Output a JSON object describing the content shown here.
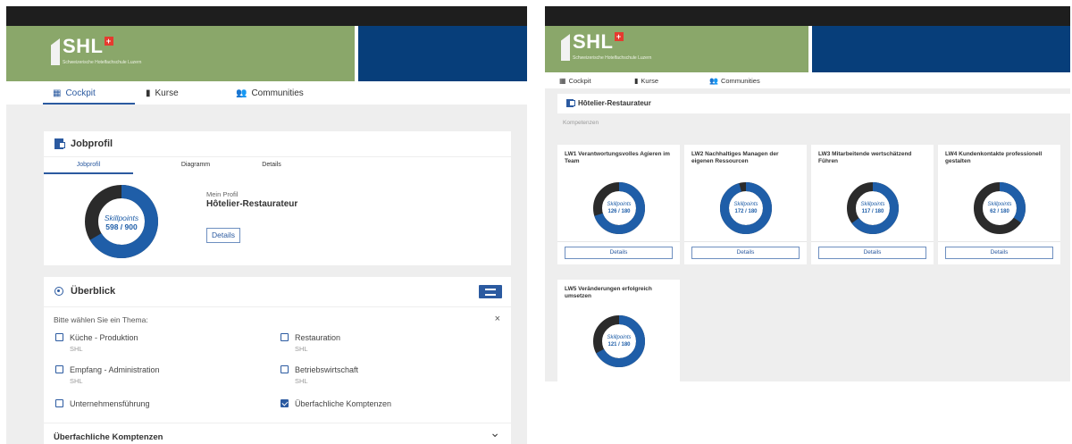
{
  "brand": {
    "logo_text": "SHL",
    "cross": "+",
    "subtitle": "Schweizerische Hotelfachschule Luzern",
    "colors": {
      "green": "#8aa76a",
      "blue": "#073e7a",
      "accent": "#2b5aa0",
      "donut_dark": "#2b2b2b"
    }
  },
  "left": {
    "nav": [
      {
        "label": "Cockpit",
        "icon": "dashboard-icon"
      },
      {
        "label": "Kurse",
        "icon": "book-icon"
      },
      {
        "label": "Communities",
        "icon": "people-icon"
      }
    ],
    "jobprofil": {
      "title": "Jobprofil",
      "tabs": [
        "Jobprofil",
        "Diagramm",
        "Details"
      ],
      "donut": {
        "label": "Skillpoints",
        "value_text": "598 / 900",
        "value": 598,
        "max": 900
      },
      "profile_label": "Mein Profil",
      "profile_name": "Hôtelier-Restaurateur",
      "details_button": "Details"
    },
    "ueberblick": {
      "title": "Überblick",
      "prompt": "Bitte wählen Sie ein Thema:",
      "close": "×",
      "options": [
        {
          "label": "Küche - Produktion",
          "sub": "SHL",
          "checked": false
        },
        {
          "label": "Restauration",
          "sub": "SHL",
          "checked": false
        },
        {
          "label": "Empfang - Administration",
          "sub": "SHL",
          "checked": false
        },
        {
          "label": "Betriebswirtschaft",
          "sub": "SHL",
          "checked": false
        },
        {
          "label": "Unternehmensführung",
          "sub": "",
          "checked": false
        },
        {
          "label": "Überfachliche Komptenzen",
          "sub": "",
          "checked": true
        }
      ],
      "section_title": "Überfachliche Komptenzen",
      "chevron": "⌄"
    }
  },
  "right": {
    "nav": [
      {
        "label": "Cockpit",
        "icon": "dashboard-icon"
      },
      {
        "label": "Kurse",
        "icon": "book-icon"
      },
      {
        "label": "Communities",
        "icon": "people-icon"
      }
    ],
    "page_title": "Hôtelier-Restaurateur",
    "section_label": "Kompetenzen",
    "competencies": [
      {
        "title": "LW1 Verantwortungsvolles Agieren im Team",
        "label": "Skillpoints",
        "value_text": "126 / 180",
        "value": 126,
        "max": 180,
        "button": "Details"
      },
      {
        "title": "LW2 Nachhaltiges Managen der eigenen Ressourcen",
        "label": "Skillpoints",
        "value_text": "172 / 180",
        "value": 172,
        "max": 180,
        "button": "Details"
      },
      {
        "title": "LW3 Mitarbeitende wertschätzend Führen",
        "label": "Skillpoints",
        "value_text": "117 / 180",
        "value": 117,
        "max": 180,
        "button": "Details"
      },
      {
        "title": "LW4 Kundenkontakte professionell gestalten",
        "label": "Skillpoints",
        "value_text": "62 / 180",
        "value": 62,
        "max": 180,
        "button": "Details"
      },
      {
        "title": "LW5 Veränderungen erfolgreich umsetzen",
        "label": "Skillpoints",
        "value_text": "121 / 180",
        "value": 121,
        "max": 180,
        "button": ""
      }
    ]
  }
}
